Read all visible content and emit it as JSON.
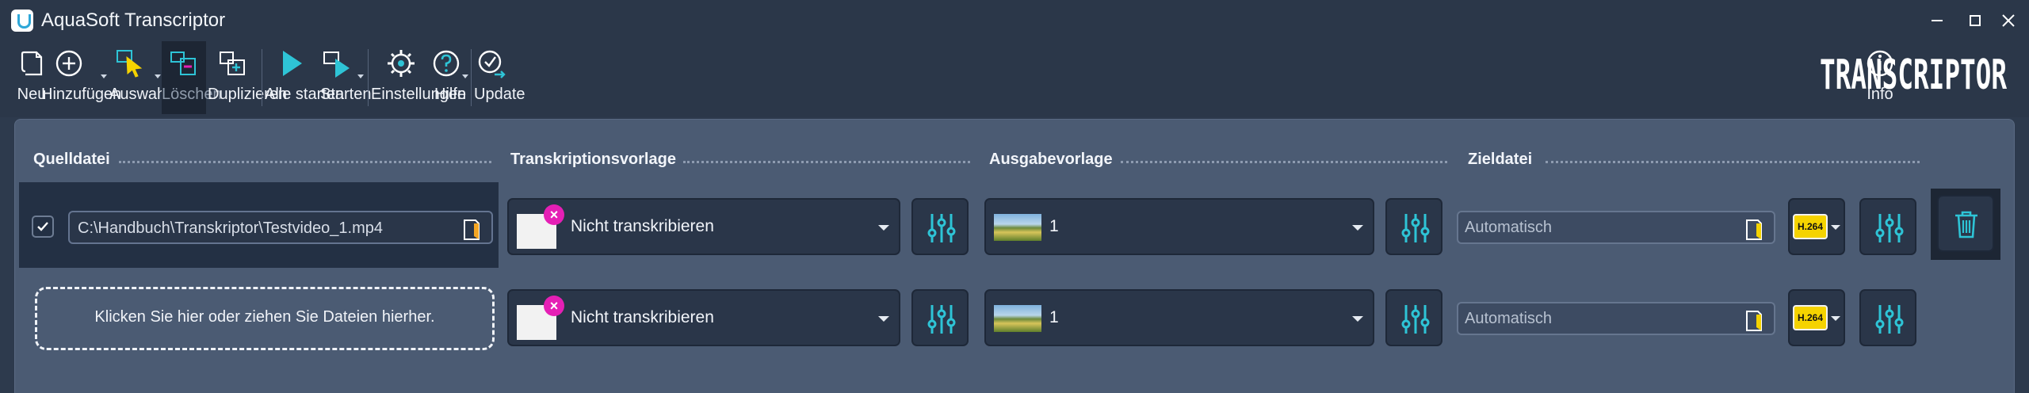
{
  "window": {
    "title": "AquaSoft Transcriptor"
  },
  "toolbar": {
    "new_label": "Neu",
    "add_label": "Hinzufügen",
    "select_label": "Auswahl",
    "delete_label": "Löschen",
    "duplicate_label": "Duplizieren",
    "start_all_label": "Alle starten",
    "start_label": "Starten",
    "settings_label": "Einstellungen",
    "help_label": "Hilfe",
    "update_label": "Update",
    "info_label": "Info"
  },
  "brand": {
    "logo": "TRANSCRIPTOR"
  },
  "columns": {
    "source": "Quelldatei",
    "template": "Transkriptionsvorlage",
    "output": "Ausgabevorlage",
    "target": "Zieldatei"
  },
  "rows": [
    {
      "checked": true,
      "source_path": "C:\\Handbuch\\Transkriptor\\Testvideo_1.mp4",
      "template": "Nicht transkribieren",
      "output": "1",
      "target_placeholder": "Automatisch",
      "codec": "H.264"
    },
    {
      "dropzone_text": "Klicken Sie hier oder ziehen Sie Dateien hierher.",
      "template": "Nicht transkribieren",
      "output": "1",
      "target_placeholder": "Automatisch",
      "codec": "H.264"
    }
  ],
  "colors": {
    "accent": "#2ec4d6",
    "badge": "#e51fb5",
    "codec": "#f5d300",
    "background": "#2d3a4d"
  }
}
